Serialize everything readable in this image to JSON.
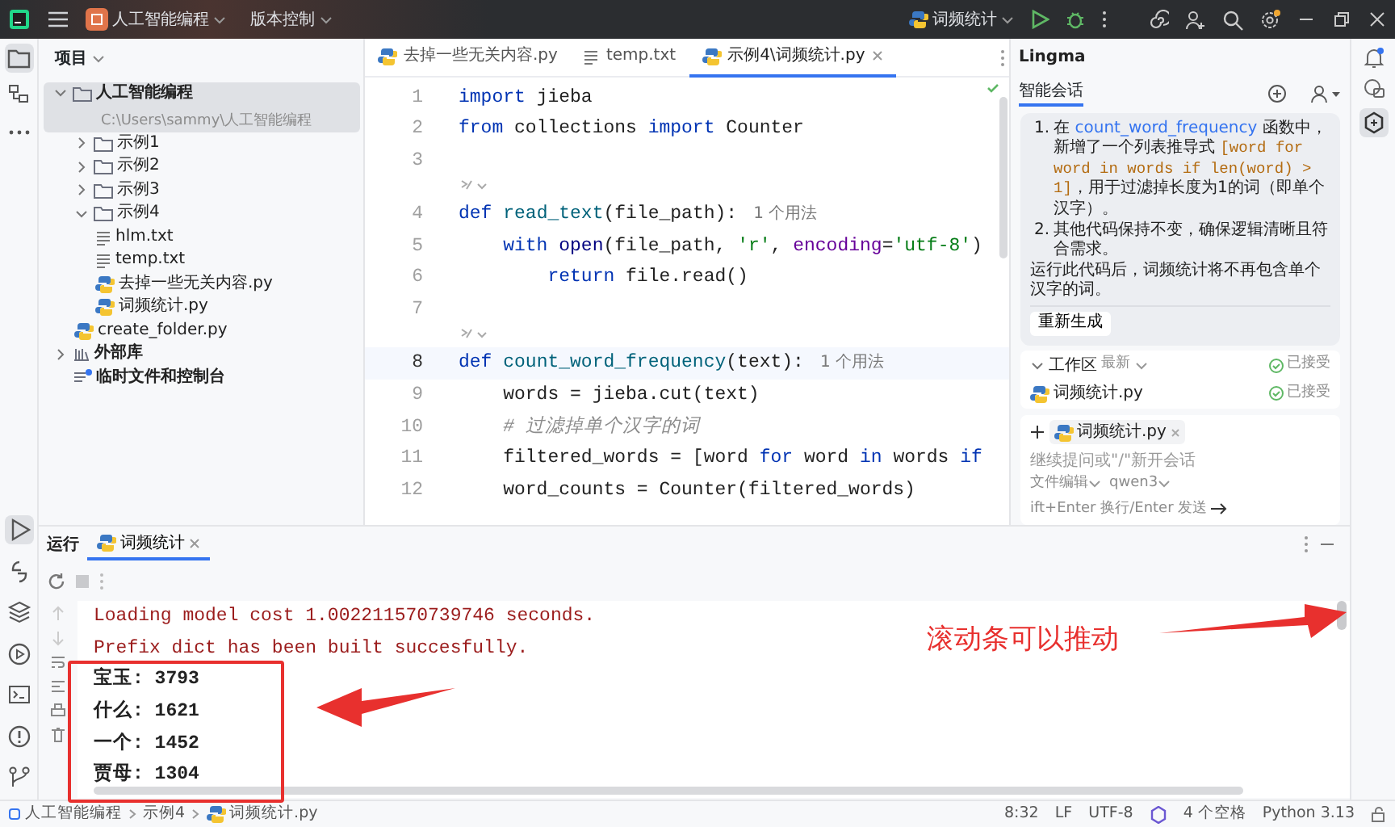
{
  "title_bar": {
    "project": "人工智能编程",
    "vcs": "版本控制",
    "run_config": "词频统计"
  },
  "tool_strip_top": [
    {
      "kind": "project",
      "selected": true
    },
    {
      "kind": "structure",
      "selected": false
    },
    {
      "kind": "more",
      "selected": false
    }
  ],
  "tool_strip_bottom": [
    {
      "kind": "run",
      "selected": true
    },
    {
      "kind": "console",
      "selected": false
    },
    {
      "kind": "packages",
      "selected": false
    },
    {
      "kind": "services",
      "selected": false
    },
    {
      "kind": "terminal",
      "selected": false
    },
    {
      "kind": "problems",
      "selected": false
    },
    {
      "kind": "git",
      "selected": false
    }
  ],
  "project_panel": {
    "header": "项目",
    "tree": [
      {
        "label": "人工智能编程",
        "path": "C:\\Users\\sammy\\人工智能编程",
        "kind": "folder",
        "expanded": true,
        "selected": true,
        "children": [
          {
            "label": "示例1",
            "kind": "folder",
            "expanded": false,
            "selected": false
          },
          {
            "label": "示例2",
            "kind": "folder",
            "expanded": false,
            "selected": false
          },
          {
            "label": "示例3",
            "kind": "folder",
            "expanded": false,
            "selected": false
          },
          {
            "label": "示例4",
            "kind": "folder",
            "expanded": true,
            "selected": false,
            "children": [
              {
                "label": "hlm.txt",
                "kind": "text",
                "selected": false
              },
              {
                "label": "temp.txt",
                "kind": "text",
                "selected": false
              },
              {
                "label": "去掉一些无关内容.py",
                "kind": "python",
                "selected": false
              },
              {
                "label": "词频统计.py",
                "kind": "python",
                "selected": false
              }
            ]
          },
          {
            "label": "create_folder.py",
            "kind": "python",
            "selected": false
          }
        ]
      },
      {
        "label": "外部库",
        "kind": "library",
        "expanded": false,
        "selected": false
      },
      {
        "label": "临时文件和控制台",
        "kind": "scratch",
        "selected": false
      }
    ]
  },
  "editor": {
    "tabs": [
      {
        "label": "去掉一些无关内容.py",
        "kind": "python",
        "selected": false
      },
      {
        "label": "temp.txt",
        "kind": "text",
        "selected": false
      },
      {
        "label": "示例4\\词频统计.py",
        "kind": "python",
        "selected": true
      }
    ],
    "lines": [
      {
        "kind": "code",
        "number": "1",
        "current": false,
        "tokens": [
          {
            "kind": "kw",
            "text": "import"
          },
          {
            "kind": "plain",
            "text": " jieba"
          }
        ]
      },
      {
        "kind": "code",
        "number": "2",
        "current": false,
        "tokens": [
          {
            "kind": "kw",
            "text": "from"
          },
          {
            "kind": "plain",
            "text": " collections "
          },
          {
            "kind": "kw",
            "text": "import"
          },
          {
            "kind": "plain",
            "text": " Counter"
          }
        ]
      },
      {
        "kind": "code",
        "number": "3",
        "current": false
      },
      {
        "kind": "hint"
      },
      {
        "kind": "code",
        "number": "4",
        "current": false,
        "tokens": [
          {
            "kind": "kw",
            "text": "def "
          },
          {
            "kind": "fn",
            "text": "read_text"
          },
          {
            "kind": "plain",
            "text": "(file_path):"
          },
          {
            "kind": "usage",
            "text": "1 个用法"
          }
        ]
      },
      {
        "kind": "code",
        "number": "5",
        "current": false,
        "tokens": [
          {
            "kind": "kw",
            "text": "    with"
          },
          {
            "kind": "builtin",
            "text": " open"
          },
          {
            "kind": "plain",
            "text": "(file_path, "
          },
          {
            "kind": "str",
            "text": "'r'"
          },
          {
            "kind": "plain",
            "text": ", "
          },
          {
            "kind": "named",
            "text": "encoding"
          },
          {
            "kind": "plain",
            "text": "="
          },
          {
            "kind": "str",
            "text": "'utf-8'"
          },
          {
            "kind": "plain",
            "text": ")"
          }
        ]
      },
      {
        "kind": "code",
        "number": "6",
        "current": false,
        "tokens": [
          {
            "kind": "kw",
            "text": "        return"
          },
          {
            "kind": "plain",
            "text": " file.read()"
          }
        ]
      },
      {
        "kind": "code",
        "number": "7",
        "current": false
      },
      {
        "kind": "hint"
      },
      {
        "kind": "code",
        "number": "8",
        "current": true,
        "tokens": [
          {
            "kind": "kw",
            "text": "def "
          },
          {
            "kind": "fn",
            "text": "count_word_frequency"
          },
          {
            "kind": "plain",
            "text": "(text):"
          },
          {
            "kind": "usage",
            "text": "1 个用法"
          }
        ]
      },
      {
        "kind": "code",
        "number": "9",
        "current": false,
        "tokens": [
          {
            "kind": "plain",
            "text": "    words = jieba.cut(text)"
          }
        ]
      },
      {
        "kind": "code",
        "number": "10",
        "current": false,
        "tokens": [
          {
            "kind": "comment",
            "text": "    # 过滤掉单个汉字的词"
          }
        ]
      },
      {
        "kind": "code",
        "number": "11",
        "current": false,
        "tokens": [
          {
            "kind": "plain",
            "text": "    filtered_words = [word "
          },
          {
            "kind": "kw",
            "text": "for"
          },
          {
            "kind": "plain",
            "text": " word "
          },
          {
            "kind": "kw",
            "text": "in"
          },
          {
            "kind": "plain",
            "text": " words "
          },
          {
            "kind": "kw",
            "text": "if"
          }
        ]
      },
      {
        "kind": "code",
        "number": "12",
        "current": false,
        "tokens": [
          {
            "kind": "plain",
            "text": "    word_counts = Counter(filtered_words)"
          }
        ]
      }
    ]
  },
  "assistant": {
    "title": "Lingma",
    "tab": "智能会话",
    "items": [
      {
        "number": "1.",
        "segments": [
          {
            "kind": "text",
            "text": "在 "
          },
          {
            "kind": "link",
            "text": "count_word_frequency"
          },
          {
            "kind": "text",
            "text": " 函数中，新增了一个列表推导式 "
          },
          {
            "kind": "code",
            "text": "[word for word in words if len(word) > 1]"
          },
          {
            "kind": "text",
            "text": "，用于过滤掉长度为1的词（即单个汉字）。"
          }
        ]
      },
      {
        "number": "2.",
        "segments": [
          {
            "kind": "text",
            "text": "其他代码保持不变，确保逻辑清晰且符合需求。"
          }
        ]
      }
    ],
    "summary": "运行此代码后，词频统计将不再包含单个汉字的词。",
    "regenerate": "重新生成",
    "workspace": {
      "label": "工作区",
      "filter": "最新",
      "status": "已接受",
      "files": [
        {
          "name": "词频统计.py",
          "status": "已接受"
        }
      ]
    },
    "input": {
      "attachment": "词频统计.py",
      "placeholder": "继续提问或\"/\"新开会话",
      "mode": "文件编辑",
      "model": "qwen3",
      "hint": "ift+Enter 换行/Enter 发送"
    }
  },
  "run_panel": {
    "title": "运行",
    "tab": "词频统计",
    "output": [
      {
        "kind": "stderr",
        "text": "Loading model cost 1.002211570739746 seconds."
      },
      {
        "kind": "stderr",
        "text": "Prefix dict has been built succesfully."
      },
      {
        "kind": "stdout",
        "text": "宝玉: 3793"
      },
      {
        "kind": "stdout",
        "text": "什么: 1621"
      },
      {
        "kind": "stdout",
        "text": "一个: 1452"
      },
      {
        "kind": "stdout",
        "text": "贾母: 1304"
      }
    ]
  },
  "annotation": {
    "note": "滚动条可以推动"
  },
  "status_bar": {
    "breadcrumbs": [
      "人工智能编程",
      "示例4",
      "词频统计.py"
    ],
    "position": "8:32",
    "line_ending": "LF",
    "encoding": "UTF-8",
    "indent": "4 个空格",
    "interpreter": "Python 3.13"
  }
}
